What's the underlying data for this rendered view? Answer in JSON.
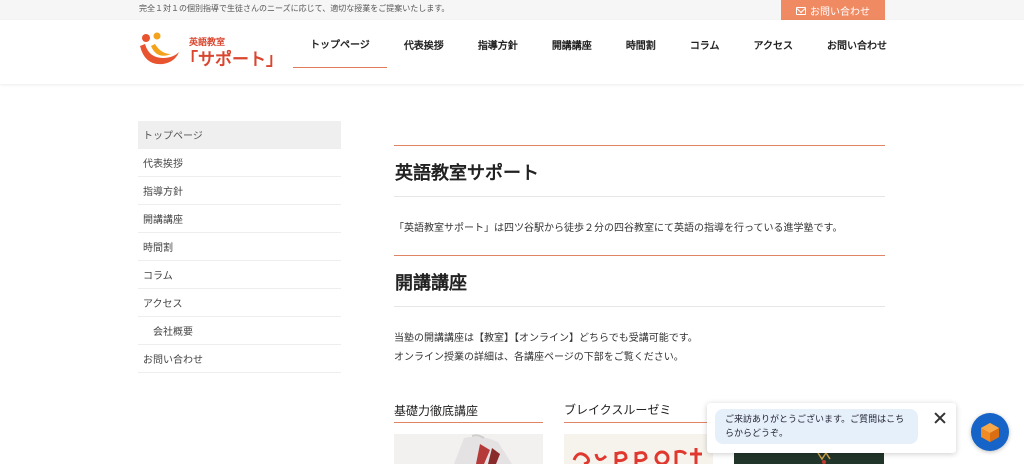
{
  "topbar": {
    "tagline": "完全１対１の個別指導で生徒さんのニーズに応じて、適切な授業をご提案いたします。",
    "contact_label": "お問い合わせ",
    "contact_icon": "envelope-icon"
  },
  "header": {
    "logo_sub": "英語教室",
    "logo_main": "「サポート」",
    "nav": [
      {
        "label": "トップページ"
      },
      {
        "label": "代表挨拶"
      },
      {
        "label": "指導方針"
      },
      {
        "label": "開講講座"
      },
      {
        "label": "時間割"
      },
      {
        "label": "コラム"
      },
      {
        "label": "アクセス"
      },
      {
        "label": "お問い合わせ"
      }
    ]
  },
  "sidebar": {
    "items": [
      {
        "label": "トップページ"
      },
      {
        "label": "代表挨拶"
      },
      {
        "label": "指導方針"
      },
      {
        "label": "開講講座"
      },
      {
        "label": "時間割"
      },
      {
        "label": "コラム"
      },
      {
        "label": "アクセス"
      },
      {
        "label": "会社概要"
      },
      {
        "label": "お問い合わせ"
      }
    ]
  },
  "main": {
    "section1_title": "英語教室サポート",
    "section1_text": "「英語教室サポート」は四ツ谷駅から徒歩２分の四谷教室にて英語の指導を行っている進学塾です。",
    "section2_title": "開講講座",
    "section2_text1": "当塾の開講講座は【教室】【オンライン】どちらでも受講可能です。",
    "section2_text2": "オンライン授業の詳細は、各講座ページの下部をご覧ください。",
    "courses": [
      {
        "title": "基礎力徹底講座"
      },
      {
        "title": "ブレイクスルーゼミ"
      }
    ]
  },
  "chat": {
    "message": "ご来訪ありがとうございます。ご質問はこちらからどうぞ。"
  },
  "colors": {
    "accent": "#ef8a63",
    "logo_red": "#d9462f",
    "chat_blue": "#1764c8"
  }
}
